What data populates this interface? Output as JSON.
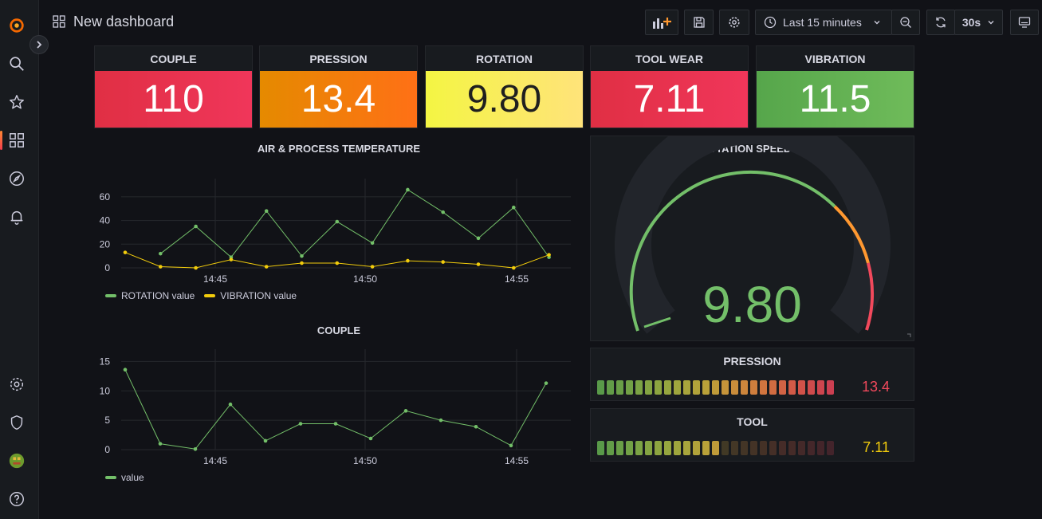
{
  "app": {
    "title": "New dashboard"
  },
  "toolbar": {
    "time_range": "Last 15 minutes",
    "refresh_interval": "30s"
  },
  "colors": {
    "green": "#73bf69",
    "yellow": "#f2cc0c",
    "red": "#f2495c",
    "orange": "#ff9830"
  },
  "stats": [
    {
      "title": "COUPLE",
      "value": "110",
      "bg": "linear-gradient(90deg,#e02f44,#f0365a)"
    },
    {
      "title": "PRESSION",
      "value": "13.4",
      "bg": "linear-gradient(90deg,#f08c00,#ff7a10)"
    },
    {
      "title": "ROTATION",
      "value": "9.80",
      "bg": "linear-gradient(90deg,#f5f543,#ffe46e)"
    },
    {
      "title": "TOOL WEAR",
      "value": "7.11",
      "bg": "linear-gradient(90deg,#e02f44,#f0365a)"
    },
    {
      "title": "VIBRATION",
      "value": "11.5",
      "bg": "linear-gradient(90deg,#56a64b,#73bf69)"
    }
  ],
  "air_chart": {
    "title": "AIR & PROCESS TEMPERATURE",
    "legend": [
      "ROTATION value",
      "VIBRATION value"
    ]
  },
  "couple_chart": {
    "title": "COUPLE",
    "legend": [
      "value"
    ]
  },
  "gauge": {
    "title": "ROTATION SPEED",
    "value": "9.80",
    "fraction": 0.0
  },
  "pression_bar": {
    "title": "PRESSION",
    "value": "13.4",
    "lit_cells": 25,
    "total_cells": 25
  },
  "tool_bar": {
    "title": "TOOL",
    "value": "7.11",
    "lit_cells": 13,
    "total_cells": 25
  },
  "chart_data": [
    {
      "type": "line",
      "title": "AIR & PROCESS TEMPERATURE",
      "xlabel": "",
      "ylabel": "",
      "x_ticks": [
        "14:45",
        "14:50",
        "14:55"
      ],
      "y_ticks": [
        0,
        20,
        40,
        60
      ],
      "ylim": [
        0,
        70
      ],
      "x": [
        "14:43",
        "14:44",
        "14:45",
        "14:46",
        "14:47",
        "14:48",
        "14:49",
        "14:50",
        "14:51",
        "14:52",
        "14:53",
        "14:54",
        "14:55",
        "14:56"
      ],
      "series": [
        {
          "name": "ROTATION value",
          "color": "#73bf69",
          "values": [
            12,
            35,
            9,
            48,
            10,
            39,
            21,
            66,
            47,
            25,
            51,
            9,
            null,
            null
          ],
          "x_offset": 1
        },
        {
          "name": "VIBRATION value",
          "color": "#f2cc0c",
          "values": [
            13,
            1,
            0,
            7,
            1,
            4,
            4,
            1,
            6,
            5,
            3,
            0,
            11,
            null
          ],
          "x_offset": 0
        }
      ],
      "grid": true,
      "legend": "bottom-left"
    },
    {
      "type": "line",
      "title": "COUPLE",
      "xlabel": "",
      "ylabel": "",
      "x_ticks": [
        "14:45",
        "14:50",
        "14:55"
      ],
      "y_ticks": [
        0,
        5,
        10,
        15
      ],
      "ylim": [
        0,
        16
      ],
      "series": [
        {
          "name": "value",
          "color": "#73bf69",
          "values": [
            13.6,
            1.0,
            0.1,
            7.7,
            1.5,
            4.4,
            4.4,
            1.9,
            6.6,
            5.0,
            3.9,
            0.7,
            11.3
          ]
        }
      ],
      "grid": true,
      "legend": "bottom-left"
    }
  ]
}
